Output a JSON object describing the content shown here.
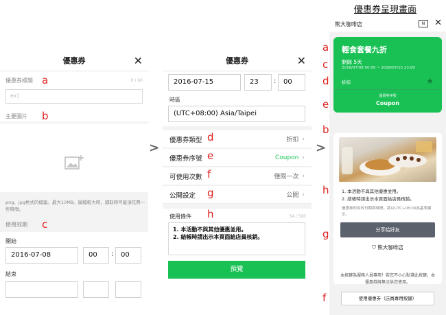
{
  "page_title": "優惠券呈現畫面",
  "panel1": {
    "header": "優惠券",
    "coupon_title_label": "優惠券標題",
    "coupon_title_counter": "0 / 60",
    "coupon_title_placeholder": "ex)",
    "main_image_label": "主要圖片",
    "image_note": "png、jpg格式的檔案。最大10MB。圖檔較大時，讀取時可能須花費一些時間。",
    "validity_label": "使用效期",
    "start_label": "開始",
    "start_date": "2016-07-08",
    "start_hour": "00",
    "start_minute": "00",
    "end_label": "結束"
  },
  "panel2": {
    "header": "優惠券",
    "date": "2016-07-15",
    "hour": "23",
    "minute": "00",
    "timezone_label": "時區",
    "timezone": "(UTC+08:00) Asia/Taipei",
    "rows": [
      {
        "label": "優惠券類型",
        "value": "折扣",
        "value_color": "#666666"
      },
      {
        "label": "優惠券序號",
        "value": "Coupon",
        "value_color": "#19c155"
      },
      {
        "label": "可使用次數",
        "value": "僅限一次",
        "value_color": "#666666"
      },
      {
        "label": "公開設定",
        "value": "公開",
        "value_color": "#666666"
      }
    ],
    "terms_label": "使用條件",
    "terms_counter": "34 / 500",
    "terms_line1": "1. 本活動不與其他優惠並用。",
    "terms_line2": "2. 結帳時請出示本頁面給店員核銷。",
    "preview_button": "預覽"
  },
  "panel3": {
    "shop_name": "熊大咖啡店",
    "coupon_title": "輕食套餐九折",
    "remaining": "剩餘 5天",
    "date_range": "2016/07/08 00:00 ~ 2016/07/15 23:00",
    "coupon_type": "折扣",
    "serial_label": "優惠券序號",
    "serial_value": "Coupon",
    "cond1": "1. 本活動不與其他優惠並用。",
    "cond2": "2. 結帳時請出示本頁面給店員核銷。",
    "tz_note": "優惠券的有效日期與時間，將以UTC+08:00為基準顯示。",
    "share_button": "分享給好友",
    "shop_link": "熊大咖啡店",
    "disclaimer": "本按鍵為服務人員專用！若您不小心點選此按鍵，本優惠券將無法供您使用。",
    "use_button": "使用優惠券（店員專用按鍵）"
  },
  "annotations": {
    "p1": [
      "a",
      "b",
      "c"
    ],
    "p2": [
      "d",
      "e",
      "f",
      "g",
      "h"
    ],
    "p3": [
      "a",
      "c",
      "d",
      "e",
      "b",
      "h",
      "g",
      "f"
    ]
  },
  "colors": {
    "accent": "#19c155",
    "marker": "#e02020"
  }
}
